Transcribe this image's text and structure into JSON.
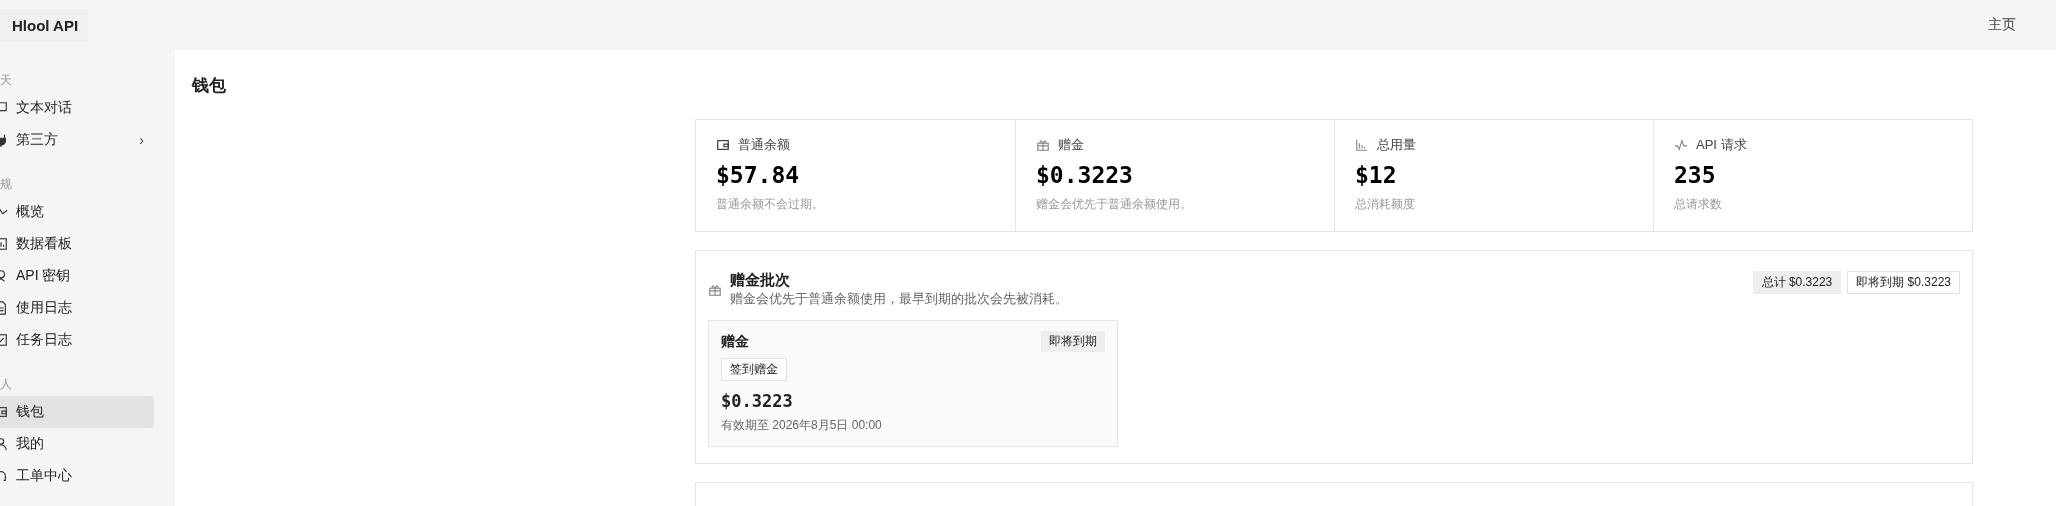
{
  "header": {
    "logo": "Hlool API",
    "nav": [
      "主页"
    ]
  },
  "sidebar": {
    "sections": [
      {
        "title": "天",
        "items": [
          {
            "label": "文本对话",
            "selected": false
          },
          {
            "label": "第三方",
            "selected": false,
            "chevron": "›"
          }
        ]
      },
      {
        "title": "规",
        "items": [
          {
            "label": "概览",
            "selected": false
          },
          {
            "label": "数据看板",
            "selected": false
          },
          {
            "label": "API 密钥",
            "selected": false
          },
          {
            "label": "使用日志",
            "selected": false
          },
          {
            "label": "任务日志",
            "selected": false
          }
        ]
      },
      {
        "title": "人",
        "items": [
          {
            "label": "钱包",
            "selected": true
          },
          {
            "label": "我的",
            "selected": false
          },
          {
            "label": "工单中心",
            "selected": false
          }
        ]
      }
    ]
  },
  "page_title": "钱包",
  "stats": [
    {
      "label": "普通余额",
      "value": "$57.84",
      "note": "普通余额不会过期。"
    },
    {
      "label": "赠金",
      "value": "$0.3223",
      "note": "赠金会优先于普通余额使用。"
    },
    {
      "label": "总用量",
      "value": "$12",
      "note": "总消耗额度"
    },
    {
      "label": "API 请求",
      "value": "235",
      "note": "总请求数"
    }
  ],
  "bonus_batches": {
    "title": "赠金批次",
    "description": "赠金会优先于普通余额使用，最早到期的批次会先被消耗。",
    "badges": [
      {
        "text": "总计 $0.3223",
        "kind": "filled"
      },
      {
        "text": "即将到期 $0.3223",
        "kind": "outlined"
      }
    ],
    "batches": [
      {
        "title": "赠金",
        "status": "即将到期",
        "source": "签到赠金",
        "amount": "$0.3223",
        "expiry": "有效期至 2026年8月5日 00:00"
      }
    ]
  }
}
